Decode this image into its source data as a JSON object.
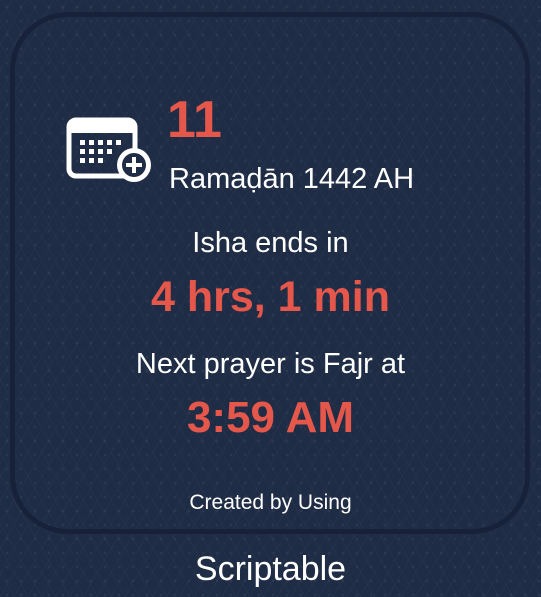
{
  "colors": {
    "background": "#1f2c45",
    "accent": "#e4574a",
    "text": "#ffffff"
  },
  "widget": {
    "icon": "calendar-add-icon",
    "hijri_day": "11",
    "hijri_month_year": "Ramaḍān 1442 AH",
    "current_prayer_label": "Isha ends in",
    "time_remaining": "4 hrs, 1 min",
    "next_prayer_label": "Next prayer is Fajr at",
    "next_prayer_time": "3:59 AM",
    "credit_text": "Created by Using"
  },
  "app": {
    "name": "Scriptable"
  }
}
